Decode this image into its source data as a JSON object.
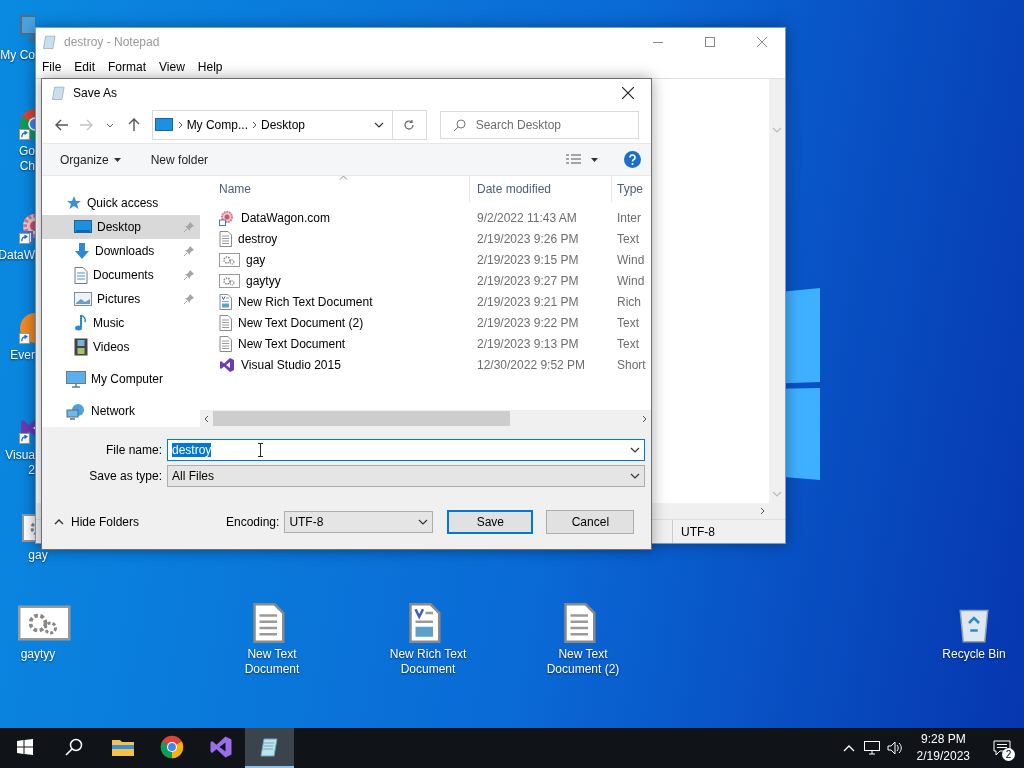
{
  "desktop": {
    "left_icons": [
      {
        "kind": "computer",
        "lines": [
          "My Co"
        ],
        "shortcut": false
      },
      {
        "kind": "chrome",
        "lines": [
          "Go",
          "Ch"
        ],
        "shortcut": true
      },
      {
        "kind": "web",
        "lines": [
          "DataW"
        ],
        "shortcut": true
      },
      {
        "kind": "orange",
        "lines": [
          "Ever"
        ],
        "shortcut": true
      },
      {
        "kind": "vs",
        "lines": [
          "Visua",
          "2"
        ],
        "shortcut": true
      },
      {
        "kind": "settings",
        "lines": [
          "gay"
        ],
        "shortcut": false
      }
    ],
    "bottom_icons": [
      {
        "kind": "settings",
        "lines": [
          "gaytyy"
        ]
      },
      {
        "kind": "text",
        "lines": [
          "New Text",
          "Document"
        ]
      },
      {
        "kind": "rich",
        "lines": [
          "New Rich Text",
          "Document"
        ]
      },
      {
        "kind": "text",
        "lines": [
          "New Text",
          "Document (2)"
        ]
      },
      {
        "kind": "recycle",
        "lines": [
          "Recycle Bin"
        ]
      }
    ]
  },
  "notepad": {
    "title": "destroy - Notepad",
    "menu": [
      "File",
      "Edit",
      "Format",
      "View",
      "Help"
    ],
    "status_bar": {
      "encoding": "UTF-8"
    }
  },
  "save_dialog": {
    "title": "Save As",
    "nav_buttons": [
      {
        "kind": "back",
        "disabled": false
      },
      {
        "kind": "forward",
        "disabled": true
      },
      {
        "kind": "recent",
        "disabled": false
      },
      {
        "kind": "up",
        "disabled": false
      }
    ],
    "address": [
      "My Comp...",
      "Desktop"
    ],
    "search": {
      "placeholder": "Search Desktop"
    },
    "toolbar": {
      "organize": "Organize",
      "new_folder": "New folder"
    },
    "nav": [
      {
        "label": "Quick access",
        "kind": "star",
        "selected": false,
        "children": [
          {
            "label": "Desktop",
            "kind": "desktop",
            "pinned": true,
            "selected": true
          },
          {
            "label": "Downloads",
            "kind": "download",
            "pinned": true,
            "selected": false
          },
          {
            "label": "Documents",
            "kind": "document",
            "pinned": true,
            "selected": false
          },
          {
            "label": "Pictures",
            "kind": "pictures",
            "pinned": true,
            "selected": false
          },
          {
            "label": "Music",
            "kind": "music",
            "pinned": false,
            "selected": false
          },
          {
            "label": "Videos",
            "kind": "videos",
            "pinned": false,
            "selected": false
          }
        ]
      },
      {
        "label": "My Computer",
        "kind": "computer",
        "selected": false
      },
      {
        "label": "Network",
        "kind": "network",
        "selected": false
      }
    ],
    "columns": [
      {
        "label": "Name",
        "sorted": true
      },
      {
        "label": "Date modified"
      },
      {
        "label": "Type"
      }
    ],
    "files": [
      {
        "name": "DataWagon.com",
        "kind": "web",
        "date": "9/2/2022 11:43 AM",
        "type": "Inter"
      },
      {
        "name": "destroy",
        "kind": "text",
        "date": "2/19/2023 9:26 PM",
        "type": "Text"
      },
      {
        "name": "gay",
        "kind": "settings",
        "date": "2/19/2023 9:15 PM",
        "type": "Wind"
      },
      {
        "name": "gaytyy",
        "kind": "settings",
        "date": "2/19/2023 9:27 PM",
        "type": "Wind"
      },
      {
        "name": "New Rich Text Document",
        "kind": "rich",
        "date": "2/19/2023 9:21 PM",
        "type": "Rich"
      },
      {
        "name": "New Text Document (2)",
        "kind": "text",
        "date": "2/19/2023 9:22 PM",
        "type": "Text"
      },
      {
        "name": "New Text Document",
        "kind": "text",
        "date": "2/19/2023 9:13 PM",
        "type": "Text"
      },
      {
        "name": "Visual Studio 2015",
        "kind": "vs",
        "date": "12/30/2022 9:52 PM",
        "type": "Short"
      }
    ],
    "file_name": {
      "label": "File name:",
      "value": "destroy"
    },
    "save_as_type": {
      "label": "Save as type:",
      "value": "All Files"
    },
    "hide_folders": "Hide Folders",
    "encoding": {
      "label": "Encoding:",
      "value": "UTF-8"
    },
    "buttons": [
      {
        "label": "Save",
        "default": true
      },
      {
        "label": "Cancel",
        "default": false
      }
    ]
  },
  "taskbar": {
    "items": [
      {
        "kind": "start",
        "active": false
      },
      {
        "kind": "search",
        "active": false
      },
      {
        "kind": "explorer",
        "active": false
      },
      {
        "kind": "chrome",
        "active": false
      },
      {
        "kind": "vs",
        "active": false
      },
      {
        "kind": "notepad",
        "active": true
      }
    ],
    "clock": {
      "time": "9:28 PM",
      "date": "2/19/2023"
    },
    "notifications": "2"
  }
}
